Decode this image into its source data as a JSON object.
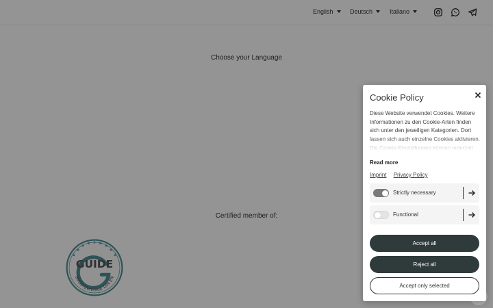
{
  "header": {
    "languages": [
      {
        "label": "English"
      },
      {
        "label": "Deutsch"
      },
      {
        "label": "Italiano"
      }
    ],
    "social": [
      "instagram-icon",
      "whatsapp-icon",
      "telegram-icon"
    ]
  },
  "main": {
    "choose_language": "Choose your Language",
    "certified": "Certified member of:"
  },
  "seal": {
    "word": "GUIDE",
    "ring_text": "BVGD-Zertifikat DIN EN",
    "color": "#4f8d96"
  },
  "cookie": {
    "title": "Cookie Policy",
    "text": "Diese Website verwendet Cookies. Weitere Informationen zu den Cookie-Arten finden sich unter den jeweiligen Kategorien. Dort lassen sich auch einzelne Cookies aktivieren. Die Cookie-Einstellungen können jederzeit",
    "read_more": "Read more",
    "links": {
      "imprint": "Imprint",
      "privacy": "Privacy Policy"
    },
    "categories": [
      {
        "label": "Strictly necessary",
        "enabled": true
      },
      {
        "label": "Functional",
        "enabled": false
      }
    ],
    "buttons": {
      "accept_all": "Accept all",
      "reject_all": "Reject all",
      "accept_selected": "Accept only selected"
    },
    "button_color": "#2f3a3b"
  }
}
